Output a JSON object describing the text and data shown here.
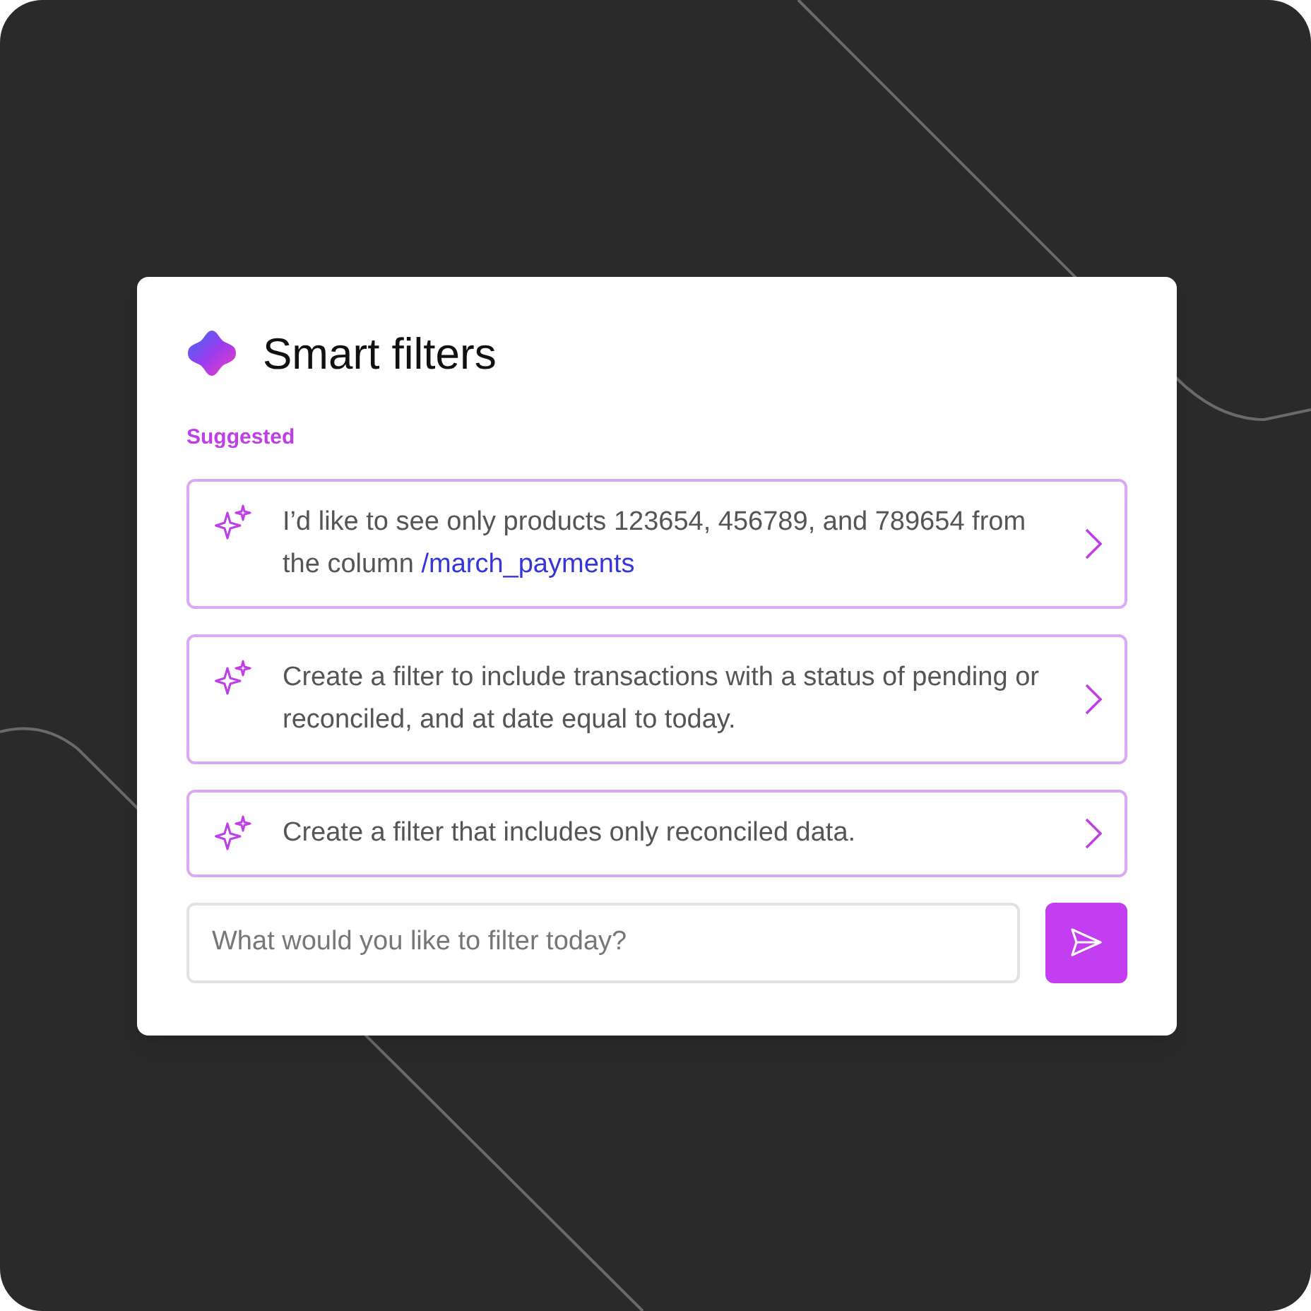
{
  "panel": {
    "title": "Smart filters",
    "section_label": "Suggested"
  },
  "suggestions": [
    {
      "text": "I’d like to see only products 123654, 456789, and 789654 from the column ",
      "link": "/march_payments"
    },
    {
      "text": "Create a filter to include transactions with a status of pending or reconciled, and at date equal to today."
    },
    {
      "text": "Create a filter that includes only reconciled data."
    }
  ],
  "prompt": {
    "placeholder": "What would you like to filter today?"
  }
}
